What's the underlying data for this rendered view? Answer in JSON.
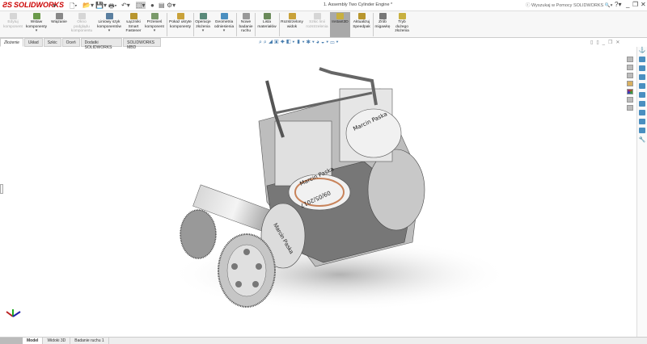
{
  "app": {
    "brand": "SOLIDWORKS",
    "document_title": "1. Assembly Two Cylinder Engine *",
    "help_search_placeholder": "Wyszukaj w Pomocy SOLIDWORKS"
  },
  "ribbon": [
    {
      "label": "Edytuj komponent",
      "enabled": false,
      "icon": "edit-component-icon"
    },
    {
      "label": "Wstaw komponenty",
      "enabled": true,
      "dropdown": true,
      "icon": "insert-components-icon"
    },
    {
      "label": "Wiązanie",
      "enabled": true,
      "icon": "mate-icon"
    },
    {
      "label": "Okno podglądu komponentu",
      "enabled": false,
      "icon": "component-preview-icon"
    },
    {
      "label": "Liniowy szyk komponentów",
      "enabled": true,
      "dropdown": true,
      "icon": "linear-pattern-icon"
    },
    {
      "label": "Łączniki Smart Fastener",
      "enabled": true,
      "icon": "smart-fasteners-icon"
    },
    {
      "label": "Przenieś komponent",
      "enabled": true,
      "dropdown": true,
      "icon": "move-component-icon"
    },
    {
      "label": "Pokaż ukryte komponenty",
      "enabled": true,
      "icon": "show-hidden-icon"
    },
    {
      "label": "Operacje złożenia",
      "enabled": true,
      "dropdown": true,
      "icon": "assembly-features-icon"
    },
    {
      "label": "Geometria odniesienia",
      "enabled": true,
      "dropdown": true,
      "icon": "reference-geometry-icon"
    },
    {
      "label": "Nowe badanie ruchu",
      "enabled": true,
      "icon": "motion-study-icon"
    },
    {
      "label": "Lista materiałów",
      "enabled": true,
      "icon": "bom-icon"
    },
    {
      "label": "Rozstrzelony widok",
      "enabled": true,
      "icon": "exploded-view-icon"
    },
    {
      "label": "Szkic linii rozstrzelenia",
      "enabled": false,
      "icon": "explode-line-sketch-icon"
    },
    {
      "label": "Instant3D",
      "enabled": true,
      "selected": true,
      "icon": "instant3d-icon"
    },
    {
      "label": "Aktualizuj Speedpak",
      "enabled": true,
      "icon": "speedpak-icon"
    },
    {
      "label": "Zrób migawkę",
      "enabled": true,
      "icon": "snapshot-icon"
    },
    {
      "label": "Tryb dużego złożenia",
      "enabled": true,
      "icon": "large-assembly-icon"
    }
  ],
  "command_tabs": [
    "Złożenie",
    "Układ",
    "Szkic",
    "Oceń",
    "Dodatki SOLIDWORKS",
    "SOLIDWORKS MBD"
  ],
  "active_command_tab": "Złożenie",
  "bottom_tabs": [
    "Model",
    "Widoki 3D",
    "Badanie ruchu 1"
  ],
  "active_bottom_tab": "Model",
  "model_engraving": {
    "name": "Marcin Paska",
    "date": "09/05/2017"
  },
  "colors": {
    "brand": "#cc0000",
    "selected_button": "#a9a9a9",
    "accent": "#4a8fc0"
  }
}
